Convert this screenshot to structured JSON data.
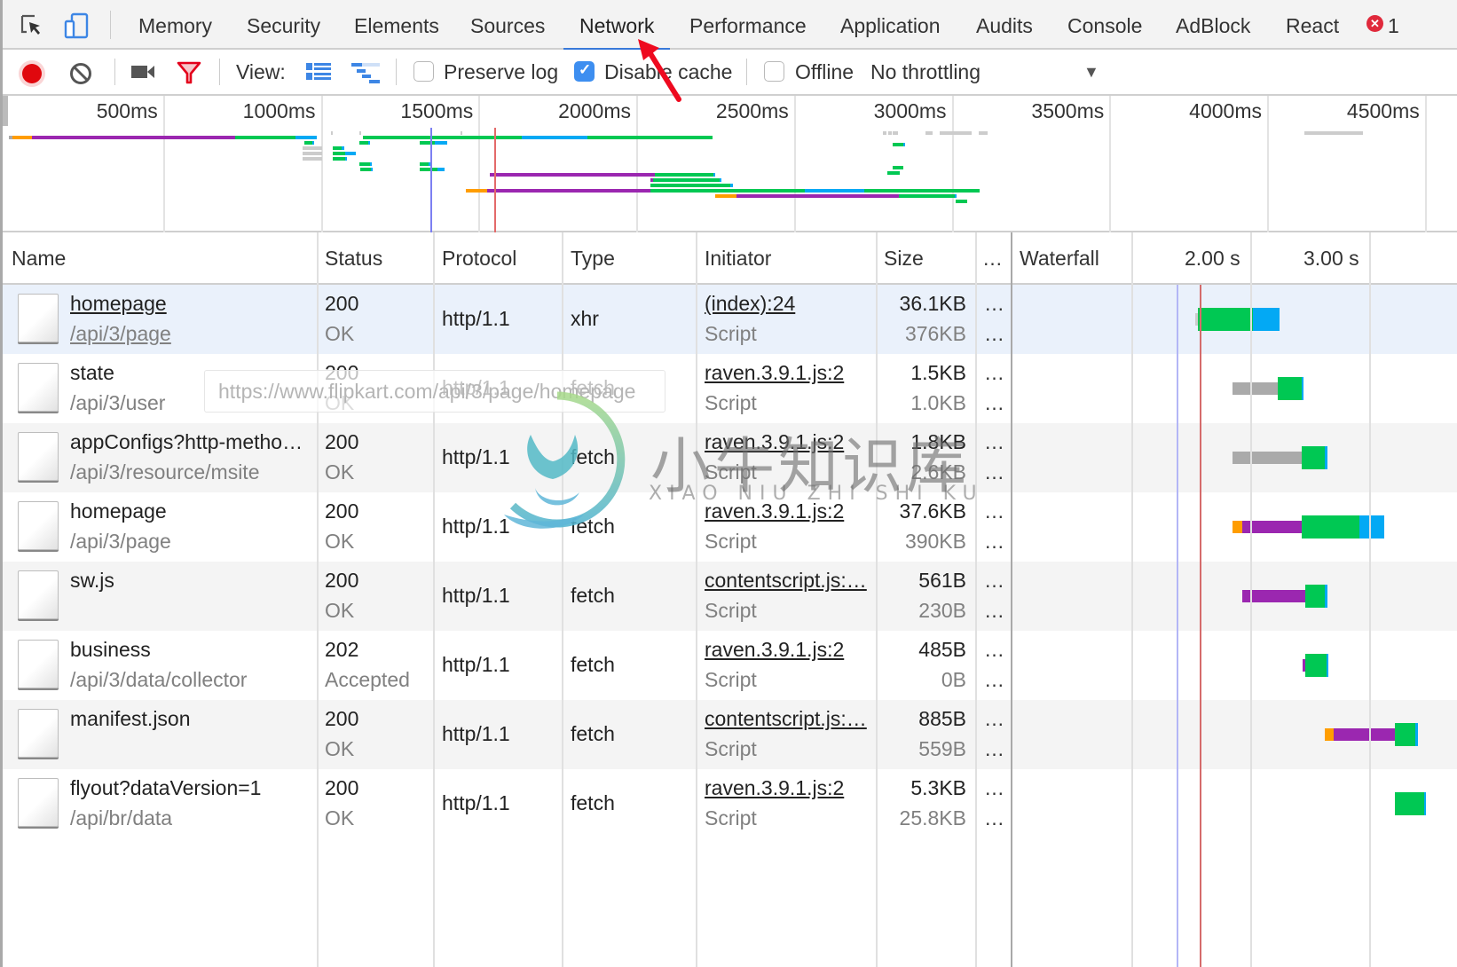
{
  "tabs": {
    "items": [
      {
        "label": "Memory",
        "active": false
      },
      {
        "label": "Security",
        "active": false
      },
      {
        "label": "Elements",
        "active": false
      },
      {
        "label": "Sources",
        "active": false
      },
      {
        "label": "Network",
        "active": true
      },
      {
        "label": "Performance",
        "active": false
      },
      {
        "label": "Application",
        "active": false
      },
      {
        "label": "Audits",
        "active": false
      },
      {
        "label": "Console",
        "active": false
      },
      {
        "label": "AdBlock",
        "active": false
      },
      {
        "label": "React",
        "active": false
      }
    ],
    "error_badge_icon": "x",
    "error_count": "1",
    "icons": [
      "inspect-element-icon",
      "device-toolbar-icon"
    ]
  },
  "toolbar": {
    "record_icon": "record-icon",
    "clear_icon": "clear-icon",
    "capture_icon": "video-camera-icon",
    "filter_icon": "filter-icon",
    "view_label": "View:",
    "preserve_log": {
      "label": "Preserve log",
      "checked": false
    },
    "disable_cache": {
      "label": "Disable cache",
      "checked": true
    },
    "offline": {
      "label": "Offline",
      "checked": false
    },
    "throttling": {
      "selected": "No throttling",
      "caret": "▼"
    }
  },
  "overview": {
    "ticks": [
      "500ms",
      "1000ms",
      "1500ms",
      "2000ms",
      "2500ms",
      "3000ms",
      "3500ms",
      "4000ms",
      "4500ms"
    ],
    "dom_content_loaded_ms": 1400,
    "load_ms": 1600
  },
  "table": {
    "columns": [
      "Name",
      "Status",
      "Protocol",
      "Type",
      "Initiator",
      "Size",
      "…",
      "Waterfall"
    ],
    "waterfall_ticks": [
      "2.00 s",
      "3.00 s"
    ],
    "rows": [
      {
        "name": "homepage",
        "path": "/api/3/page",
        "status": "200",
        "status_text": "OK",
        "protocol": "http/1.1",
        "type": "xhr",
        "initiator": "(index):24",
        "initiator_type": "Script",
        "size": "36.1KB",
        "resource_size": "376KB",
        "more1": "…",
        "more2": "…",
        "selected": true
      },
      {
        "name": "state",
        "path": "/api/3/user",
        "status": "200",
        "status_text": "OK",
        "protocol": "http/1.1",
        "type": "fetch",
        "initiator": "raven.3.9.1.js:2",
        "initiator_type": "Script",
        "size": "1.5KB",
        "resource_size": "1.0KB",
        "more1": "…",
        "more2": "…"
      },
      {
        "name": "appConfigs?http-metho…",
        "path": "/api/3/resource/msite",
        "status": "200",
        "status_text": "OK",
        "protocol": "http/1.1",
        "type": "fetch",
        "initiator": "raven.3.9.1.js:2",
        "initiator_type": "Script",
        "size": "1.8KB",
        "resource_size": "2.6KB",
        "more1": "…",
        "more2": "…"
      },
      {
        "name": "homepage",
        "path": "/api/3/page",
        "status": "200",
        "status_text": "OK",
        "protocol": "http/1.1",
        "type": "fetch",
        "initiator": "raven.3.9.1.js:2",
        "initiator_type": "Script",
        "size": "37.6KB",
        "resource_size": "390KB",
        "more1": "…",
        "more2": "…"
      },
      {
        "name": "sw.js",
        "path": "",
        "status": "200",
        "status_text": "OK",
        "protocol": "http/1.1",
        "type": "fetch",
        "initiator": "contentscript.js:…",
        "initiator_type": "Script",
        "size": "561B",
        "resource_size": "230B",
        "more1": "…",
        "more2": "…"
      },
      {
        "name": "business",
        "path": "/api/3/data/collector",
        "status": "202",
        "status_text": "Accepted",
        "protocol": "http/1.1",
        "type": "fetch",
        "initiator": "raven.3.9.1.js:2",
        "initiator_type": "Script",
        "size": "485B",
        "resource_size": "0B",
        "more1": "…",
        "more2": "…"
      },
      {
        "name": "manifest.json",
        "path": "",
        "status": "200",
        "status_text": "OK",
        "protocol": "http/1.1",
        "type": "fetch",
        "initiator": "contentscript.js:…",
        "initiator_type": "Script",
        "size": "885B",
        "resource_size": "559B",
        "more1": "…",
        "more2": "…"
      },
      {
        "name": "flyout?dataVersion=1",
        "path": "/api/br/data",
        "status": "200",
        "status_text": "OK",
        "protocol": "http/1.1",
        "type": "fetch",
        "initiator": "raven.3.9.1.js:2",
        "initiator_type": "Script",
        "size": "5.3KB",
        "resource_size": "25.8KB",
        "more1": "…",
        "more2": "…"
      }
    ]
  },
  "waterfall_timing_s": [
    {
      "queue": [
        1.54,
        1.56
      ],
      "wait": [
        1.56,
        2.02
      ],
      "download": [
        2.02,
        2.25
      ]
    },
    {
      "stalled": [
        1.85,
        2.23
      ],
      "wait": [
        2.23,
        2.43
      ],
      "download": [
        2.43,
        2.45
      ]
    },
    {
      "stalled": [
        1.85,
        2.43
      ],
      "wait": [
        2.43,
        2.63
      ],
      "download": [
        2.63,
        2.65
      ]
    },
    {
      "dns": [
        1.85,
        1.93
      ],
      "connect": [
        1.93,
        2.43
      ],
      "wait": [
        2.43,
        2.92
      ],
      "download": [
        2.92,
        3.13
      ]
    },
    {
      "connect": [
        1.93,
        2.46
      ],
      "wait": [
        2.46,
        2.63
      ],
      "download": [
        2.63,
        2.65
      ]
    },
    {
      "connect": [
        2.44,
        2.46
      ],
      "wait": [
        2.46,
        2.64
      ],
      "download": [
        2.64,
        2.66
      ]
    },
    {
      "dns": [
        2.63,
        2.7
      ],
      "connect": [
        2.7,
        3.22
      ],
      "wait": [
        3.22,
        3.39
      ],
      "download": [
        3.39,
        3.41
      ]
    },
    {
      "wait": [
        3.22,
        3.46
      ],
      "download": [
        3.46,
        3.48
      ]
    }
  ],
  "tooltip": "https://www.flipkart.com/api/3/page/homepage",
  "watermark": {
    "title": "小牛知识库",
    "subtitle": "XIAO NIU ZHI SHI KU"
  },
  "colors": {
    "accent": "#3879d9",
    "record": "#e0080e",
    "filter": "#e3001b",
    "queue": "#ff9d00",
    "connect": "#9b27b0",
    "wait": "#00c853",
    "download": "#03a9f4",
    "stalled": "#aaaaaa",
    "dcl_line": "#7c80f2",
    "load_line": "#e36a6a"
  }
}
